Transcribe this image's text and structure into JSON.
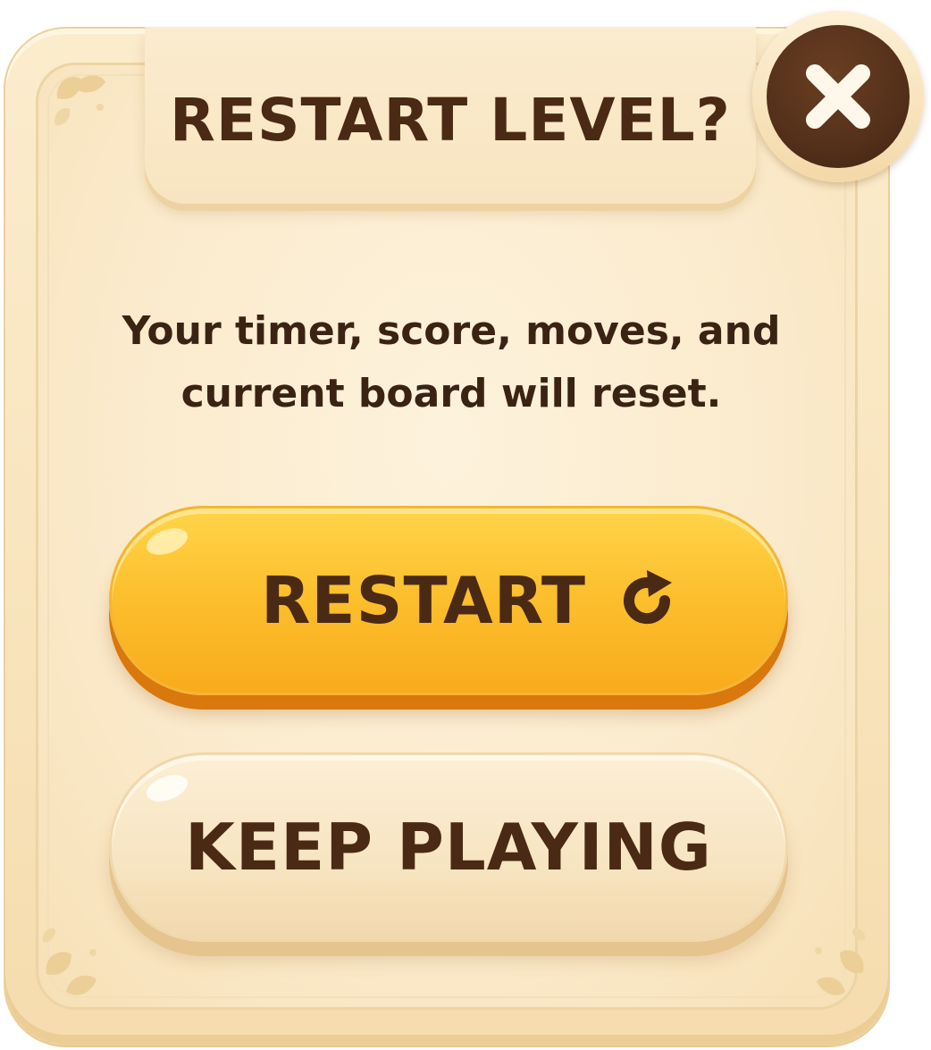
{
  "dialog": {
    "title": "RESTART LEVEL?",
    "close_icon": "close-icon",
    "message_lines": [
      "Your timer, score, moves, and",
      "current board will reset."
    ]
  },
  "buttons": {
    "restart_label": "RESTART",
    "restart_icon": "restart-arrow-icon",
    "keep_playing_label": "KEEP PLAYING"
  },
  "colors": {
    "panel": "#f9e5bf",
    "text_brown": "#4a2a14",
    "restart_button": "#fcc02e",
    "restart_button_shadow": "#d9780c",
    "close_button": "#54301a"
  }
}
